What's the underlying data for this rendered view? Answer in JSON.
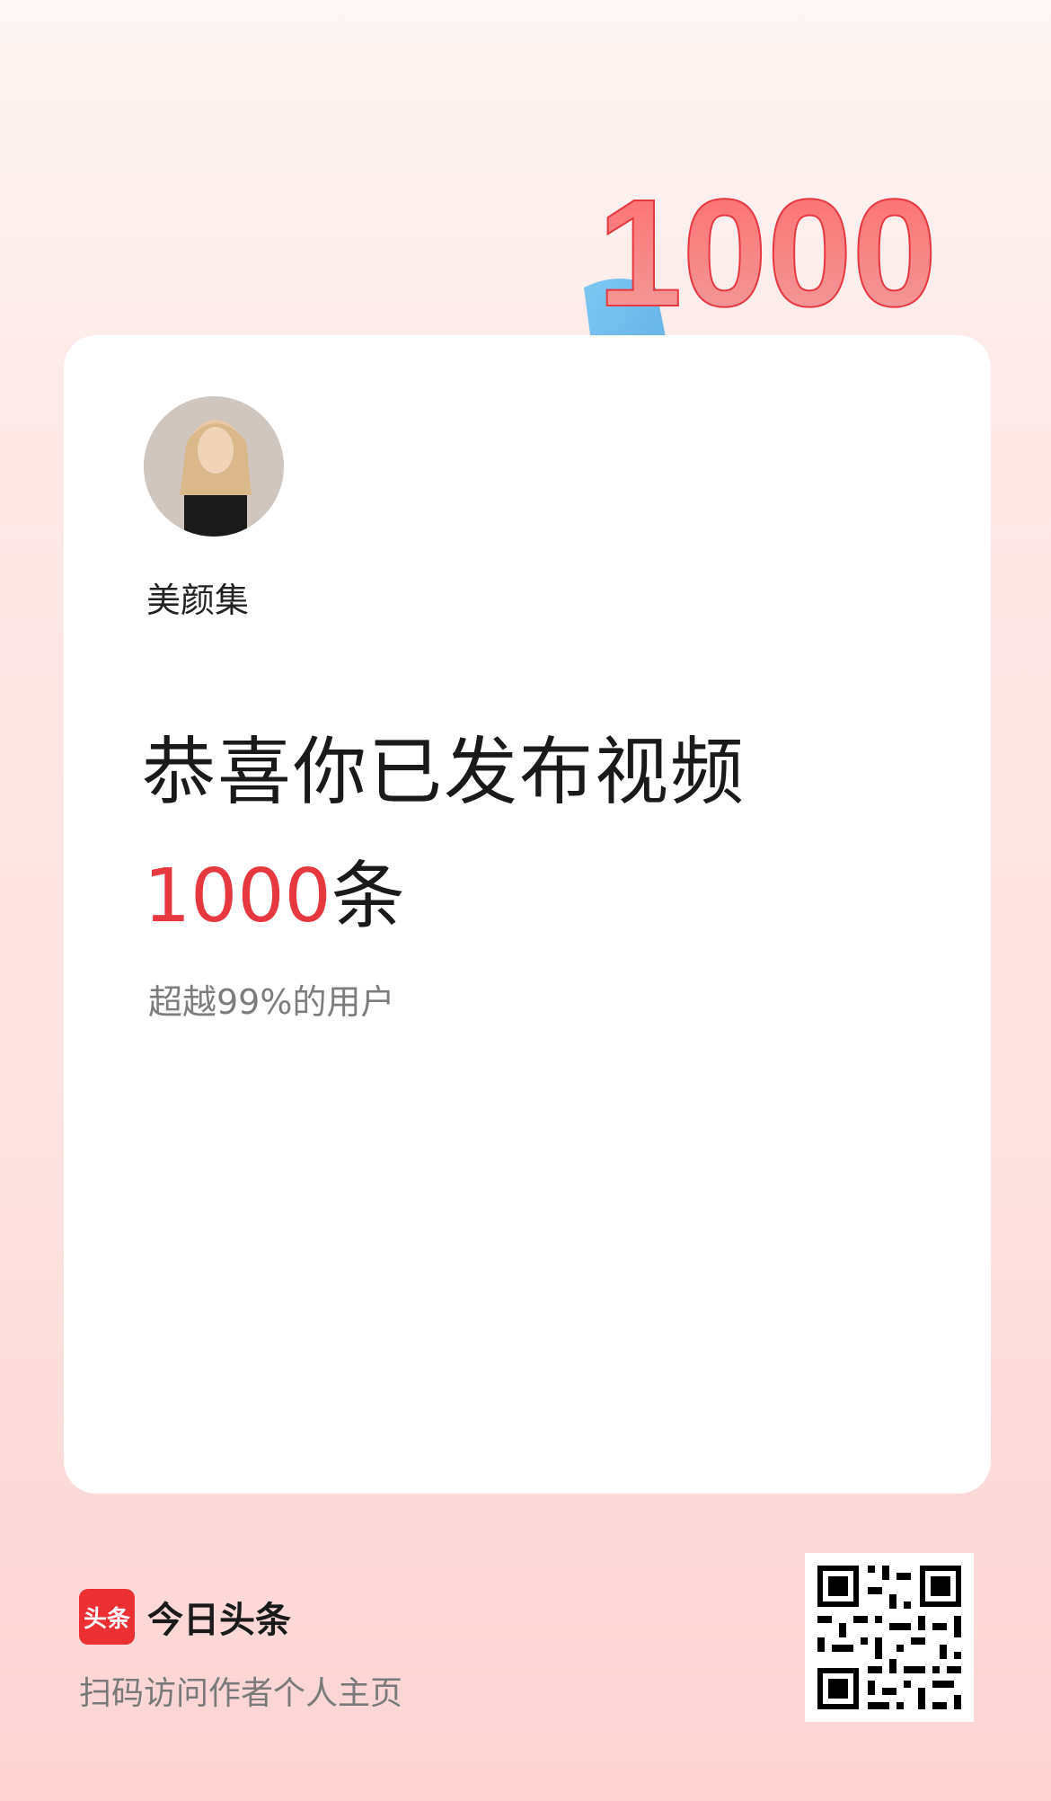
{
  "badge": {
    "number": "1000"
  },
  "user": {
    "name": "美颜集"
  },
  "congrats": {
    "line1": "恭喜你已发布视频",
    "count": "1000",
    "unit": "条",
    "sub": "超越99%的用户"
  },
  "footer": {
    "logo_text": "头条",
    "app_name": "今日头条",
    "hint": "扫码访问作者个人主页"
  },
  "colors": {
    "accent": "#e8383f",
    "brand": "#ec2f33"
  }
}
